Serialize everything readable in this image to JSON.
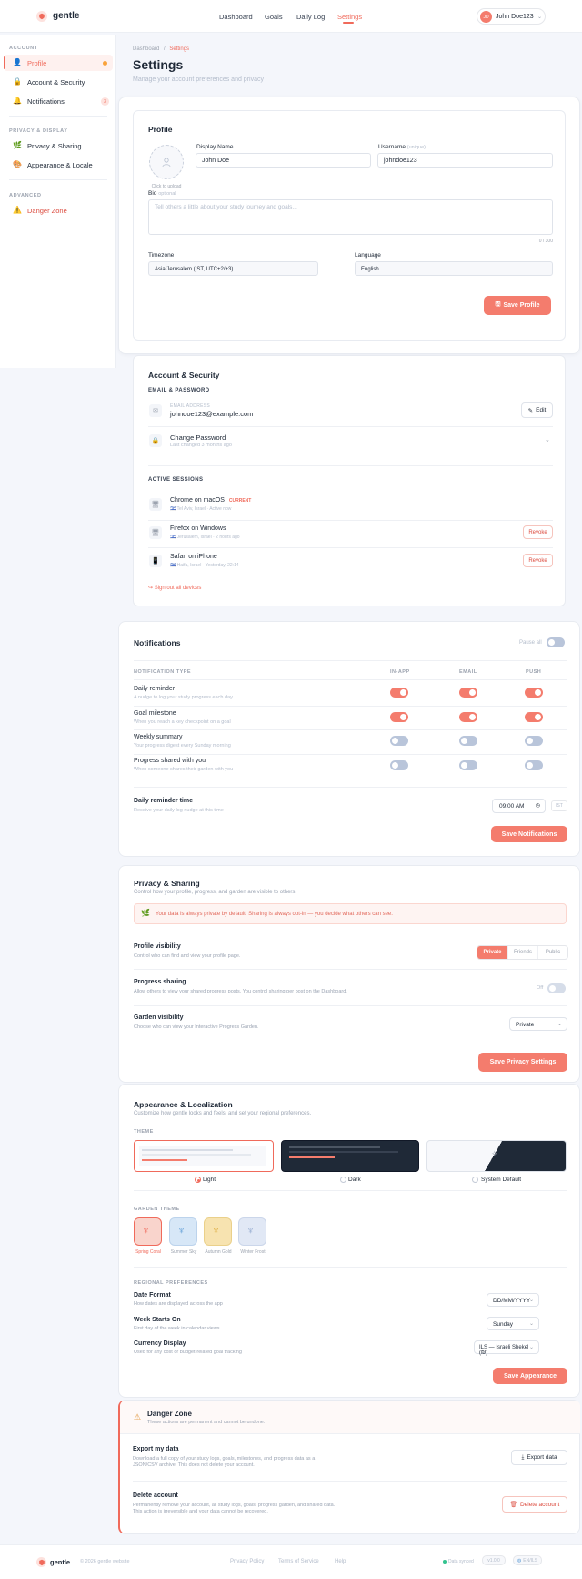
{
  "app": {
    "brand": "gentle"
  },
  "nav": {
    "items": [
      "Dashboard",
      "Goals",
      "Daily Log",
      "Settings"
    ],
    "active": "Settings"
  },
  "user": {
    "initials": "JD",
    "name": "John Doe123"
  },
  "sidebar": {
    "sections": [
      "ACCOUNT",
      "PRIVACY & DISPLAY",
      "ADVANCED"
    ],
    "items": [
      {
        "label": "Profile",
        "icon": "person-icon"
      },
      {
        "label": "Account & Security",
        "icon": "lock-icon"
      },
      {
        "label": "Notifications",
        "icon": "bell-icon",
        "badge": "3"
      },
      {
        "label": "Privacy & Sharing",
        "icon": "leaf-icon"
      },
      {
        "label": "Appearance & Locale",
        "icon": "palette-icon"
      },
      {
        "label": "Danger Zone",
        "icon": "warning-icon"
      }
    ]
  },
  "page": {
    "breadcrumb": [
      "Dashboard",
      "Settings"
    ],
    "title": "Settings",
    "subtitle": "Manage your account preferences and privacy"
  },
  "profile": {
    "title": "Profile",
    "avatar_hint": "Click to upload",
    "display_name_label": "Display Name",
    "display_name_value": "John Doe",
    "username_label": "Username",
    "username_hint": "(unique)",
    "username_value": "johndoe123",
    "bio_label": "Bio",
    "bio_hint": "optional",
    "bio_placeholder": "Tell others a little about your study journey and goals...",
    "bio_count": "0 / 300",
    "timezone_label": "Timezone",
    "timezone_value": "Asia/Jerusalem (IST, UTC+2/+3)",
    "language_label": "Language",
    "language_value": "English",
    "save_label": "Save Profile"
  },
  "account": {
    "title": "Account & Security",
    "email_section": "EMAIL & PASSWORD",
    "email_label": "EMAIL ADDRESS",
    "email_value": "johndoe123@example.com",
    "edit_label": "Edit",
    "password_title": "Change Password",
    "password_sub": "Last changed 3 months ago",
    "sessions_section": "ACTIVE SESSIONS",
    "sessions": [
      {
        "device": "Chrome on macOS",
        "badge": "CURRENT",
        "location": "Tel Aviv, Israel",
        "time": "Active now"
      },
      {
        "device": "Firefox on Windows",
        "location": "Jerusalem, Israel",
        "time": "2 hours ago",
        "action": "Revoke"
      },
      {
        "device": "Safari on iPhone",
        "location": "Haifa, Israel",
        "time": "Yesterday, 22:14",
        "action": "Revoke"
      }
    ],
    "sign_out_all": "Sign out all devices"
  },
  "notifications": {
    "title": "Notifications",
    "pause_label": "Pause all",
    "columns": [
      "NOTIFICATION TYPE",
      "IN-APP",
      "EMAIL",
      "PUSH"
    ],
    "rows": [
      {
        "title": "Daily reminder",
        "sub": "A nudge to log your study progress each day",
        "in_app": true,
        "email": true,
        "push": true
      },
      {
        "title": "Goal milestone",
        "sub": "When you reach a key checkpoint on a goal",
        "in_app": true,
        "email": true,
        "push": true
      },
      {
        "title": "Weekly summary",
        "sub": "Your progress digest every Sunday morning",
        "in_app": false,
        "email": false,
        "push": false
      },
      {
        "title": "Progress shared with you",
        "sub": "When someone shares their garden with you",
        "in_app": false,
        "email": false,
        "push": false
      }
    ],
    "reminder_title": "Daily reminder time",
    "reminder_sub": "Receive your daily log nudge at this time",
    "reminder_time": "09:00 AM",
    "reminder_tz": "IST",
    "save_label": "Save Notifications"
  },
  "privacy": {
    "title": "Privacy & Sharing",
    "subtitle": "Control how your profile, progress, and garden are visible to others.",
    "banner": "Your data is always private by default. Sharing is always opt-in — you decide what others can see.",
    "visibility_title": "Profile visibility",
    "visibility_sub": "Control who can find and view your profile page.",
    "visibility_options": [
      "Private",
      "Friends",
      "Public"
    ],
    "visibility_selected": "Private",
    "progress_title": "Progress sharing",
    "progress_sub": "Allow others to view your shared progress posts. You control sharing per post on the Dashboard.",
    "progress_state": "Off",
    "garden_title": "Garden visibility",
    "garden_sub": "Choose who can view your Interactive Progress Garden.",
    "garden_value": "Private",
    "save_label": "Save Privacy Settings"
  },
  "appearance": {
    "title": "Appearance & Localization",
    "subtitle": "Customize how gentle looks and feels, and set your regional preferences.",
    "theme_section": "THEME",
    "themes": [
      "Light",
      "Dark",
      "System Default"
    ],
    "theme_selected": "Light",
    "garden_section": "GARDEN THEME",
    "garden_themes": [
      {
        "label": "Spring Coral",
        "color": "#f9d4cc"
      },
      {
        "label": "Summer Sky",
        "color": "#d7e7f7"
      },
      {
        "label": "Autumn Gold",
        "color": "#f7e3b0"
      },
      {
        "label": "Winter Frost",
        "color": "#e1e8f5"
      }
    ],
    "garden_selected": "Spring Coral",
    "regional_section": "REGIONAL PREFERENCES",
    "date_title": "Date Format",
    "date_sub": "How dates are displayed across the app",
    "date_value": "DD/MM/YYYY",
    "week_title": "Week Starts On",
    "week_sub": "First day of the week in calendar views",
    "week_value": "Sunday",
    "currency_title": "Currency Display",
    "currency_sub": "Used for any cost or budget-related goal tracking",
    "currency_value": "ILS — Israeli Shekel (₪)",
    "save_label": "Save Appearance"
  },
  "danger": {
    "title": "Danger Zone",
    "subtitle": "These actions are permanent and cannot be undone.",
    "export_title": "Export my data",
    "export_sub": "Download a full copy of your study logs, goals, milestones, and progress data as a JSON/CSV archive. This does not delete your account.",
    "export_label": "Export data",
    "delete_title": "Delete account",
    "delete_sub": "Permanently remove your account, all study logs, goals, progress garden, and shared data. This action is irreversible and your data cannot be recovered.",
    "delete_label": "Delete account"
  },
  "footer": {
    "brand": "gentle",
    "copyright": "© 2026 gentle website",
    "links": [
      "Privacy Policy",
      "Terms of Service",
      "Help"
    ],
    "status": "Data synced",
    "version": "v1.0.0",
    "locale": "EN/ILS"
  }
}
